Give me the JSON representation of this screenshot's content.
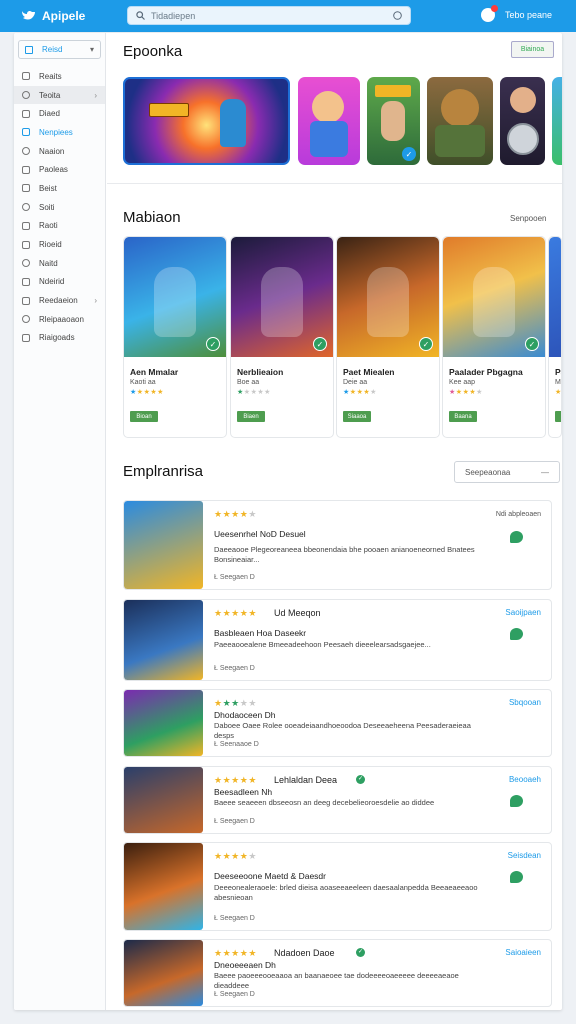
{
  "header": {
    "app_name": "Apipele",
    "search_placeholder": "Tidadiepen",
    "user_label": "Tebo peane"
  },
  "sidebar": {
    "select_label": "Reisd",
    "items": [
      {
        "label": "Reaits"
      },
      {
        "label": "Teoita"
      },
      {
        "label": "Diaed"
      },
      {
        "label": "Nenpiees"
      },
      {
        "label": "Naaion"
      },
      {
        "label": "Paoleas"
      },
      {
        "label": "Beist"
      },
      {
        "label": "Soiti"
      },
      {
        "label": "Raoti"
      },
      {
        "label": "Rioeid"
      },
      {
        "label": "Naitd"
      },
      {
        "label": "Ndeirid"
      },
      {
        "label": "Reedaeion"
      },
      {
        "label": "Rleipaaoaon"
      },
      {
        "label": "Riaigoads"
      }
    ]
  },
  "featured": {
    "title": "Epoonka",
    "button": "Biainoa"
  },
  "popular": {
    "title": "Mabiaon",
    "see_all": "Senpooen",
    "cards": [
      {
        "title": "Aen Mmalar",
        "subtitle": "Kaoti aa",
        "tag": "Bioan"
      },
      {
        "title": "Nerblieaion",
        "subtitle": "Boe aa",
        "tag": "Biaen"
      },
      {
        "title": "Paet Miealen",
        "subtitle": "Deie aa",
        "tag": "Siaaoa"
      },
      {
        "title": "Paalader Pbgagna",
        "subtitle": "Kee aap",
        "tag": "Baana"
      },
      {
        "title": "Pa",
        "subtitle": "M",
        "tag": "N"
      }
    ]
  },
  "reviews_section": {
    "title": "Emplranrisa",
    "sort_label": "Seepeaonaa"
  },
  "reviews": [
    {
      "name": "",
      "meta": "Ndi abpleoaen",
      "link": "",
      "headline": "Ueesenrhel NoD Desuel",
      "text": "Daeeaooe Plegeoreaneea bbeonendaia bhe pooaen anianoeneorned Bnatees Bonsineaiar...",
      "footer": "Ł Seegaen D"
    },
    {
      "name": "Ud Meeqon",
      "meta": "",
      "link": "Saoijpaen",
      "headline": "Basbleaen Hoa Daseekr",
      "text": "Paeeaooealene Bmeeadeehoon Peesaeh dieeelearsadsgaejee...",
      "footer": "Ł Seegaen D"
    },
    {
      "name": "",
      "meta": "",
      "link": "Sbqooan",
      "headline": "Dhodaoceen Dh",
      "text": "Daboee Oaee Rolee ooeadeiaandhoeoodoa Deseeaeheena Peesaderaeieaa desps",
      "footer": "Ł Seenaaoe D"
    },
    {
      "name": "Lehlaldan Deea",
      "meta": "",
      "link": "Beooaeh",
      "headline": "Beesadleen Nh",
      "text": "Baeee seaeeen dbseeosn an deeg decebelieoroesdelie ao diddee",
      "footer": "Ł Seegaen D"
    },
    {
      "name": "",
      "meta": "",
      "link": "Seisdean",
      "headline": "Deeseeoone Maetd & Daesdr",
      "text": "Deeeonealeraoele: brled dieisa aoaseeaeeleen daesaalanpedda Beeaeaeeaoo abesnieoan",
      "footer": "Ł Seegaen D"
    },
    {
      "name": "Ndadoen Daoe",
      "meta": "",
      "link": "Saioaieen",
      "headline": "Dneoeeeaen Dh",
      "text": "Baeee paoeeeooeaaoa an baanaeoee tae dodeeeeoaeeeee deeeeaeaoe dieaddeee",
      "footer": "Ł Seegaen D"
    }
  ],
  "colors": {
    "brand": "#1d9be8",
    "accent_green": "#2e9f62",
    "star": "#f1b526"
  }
}
